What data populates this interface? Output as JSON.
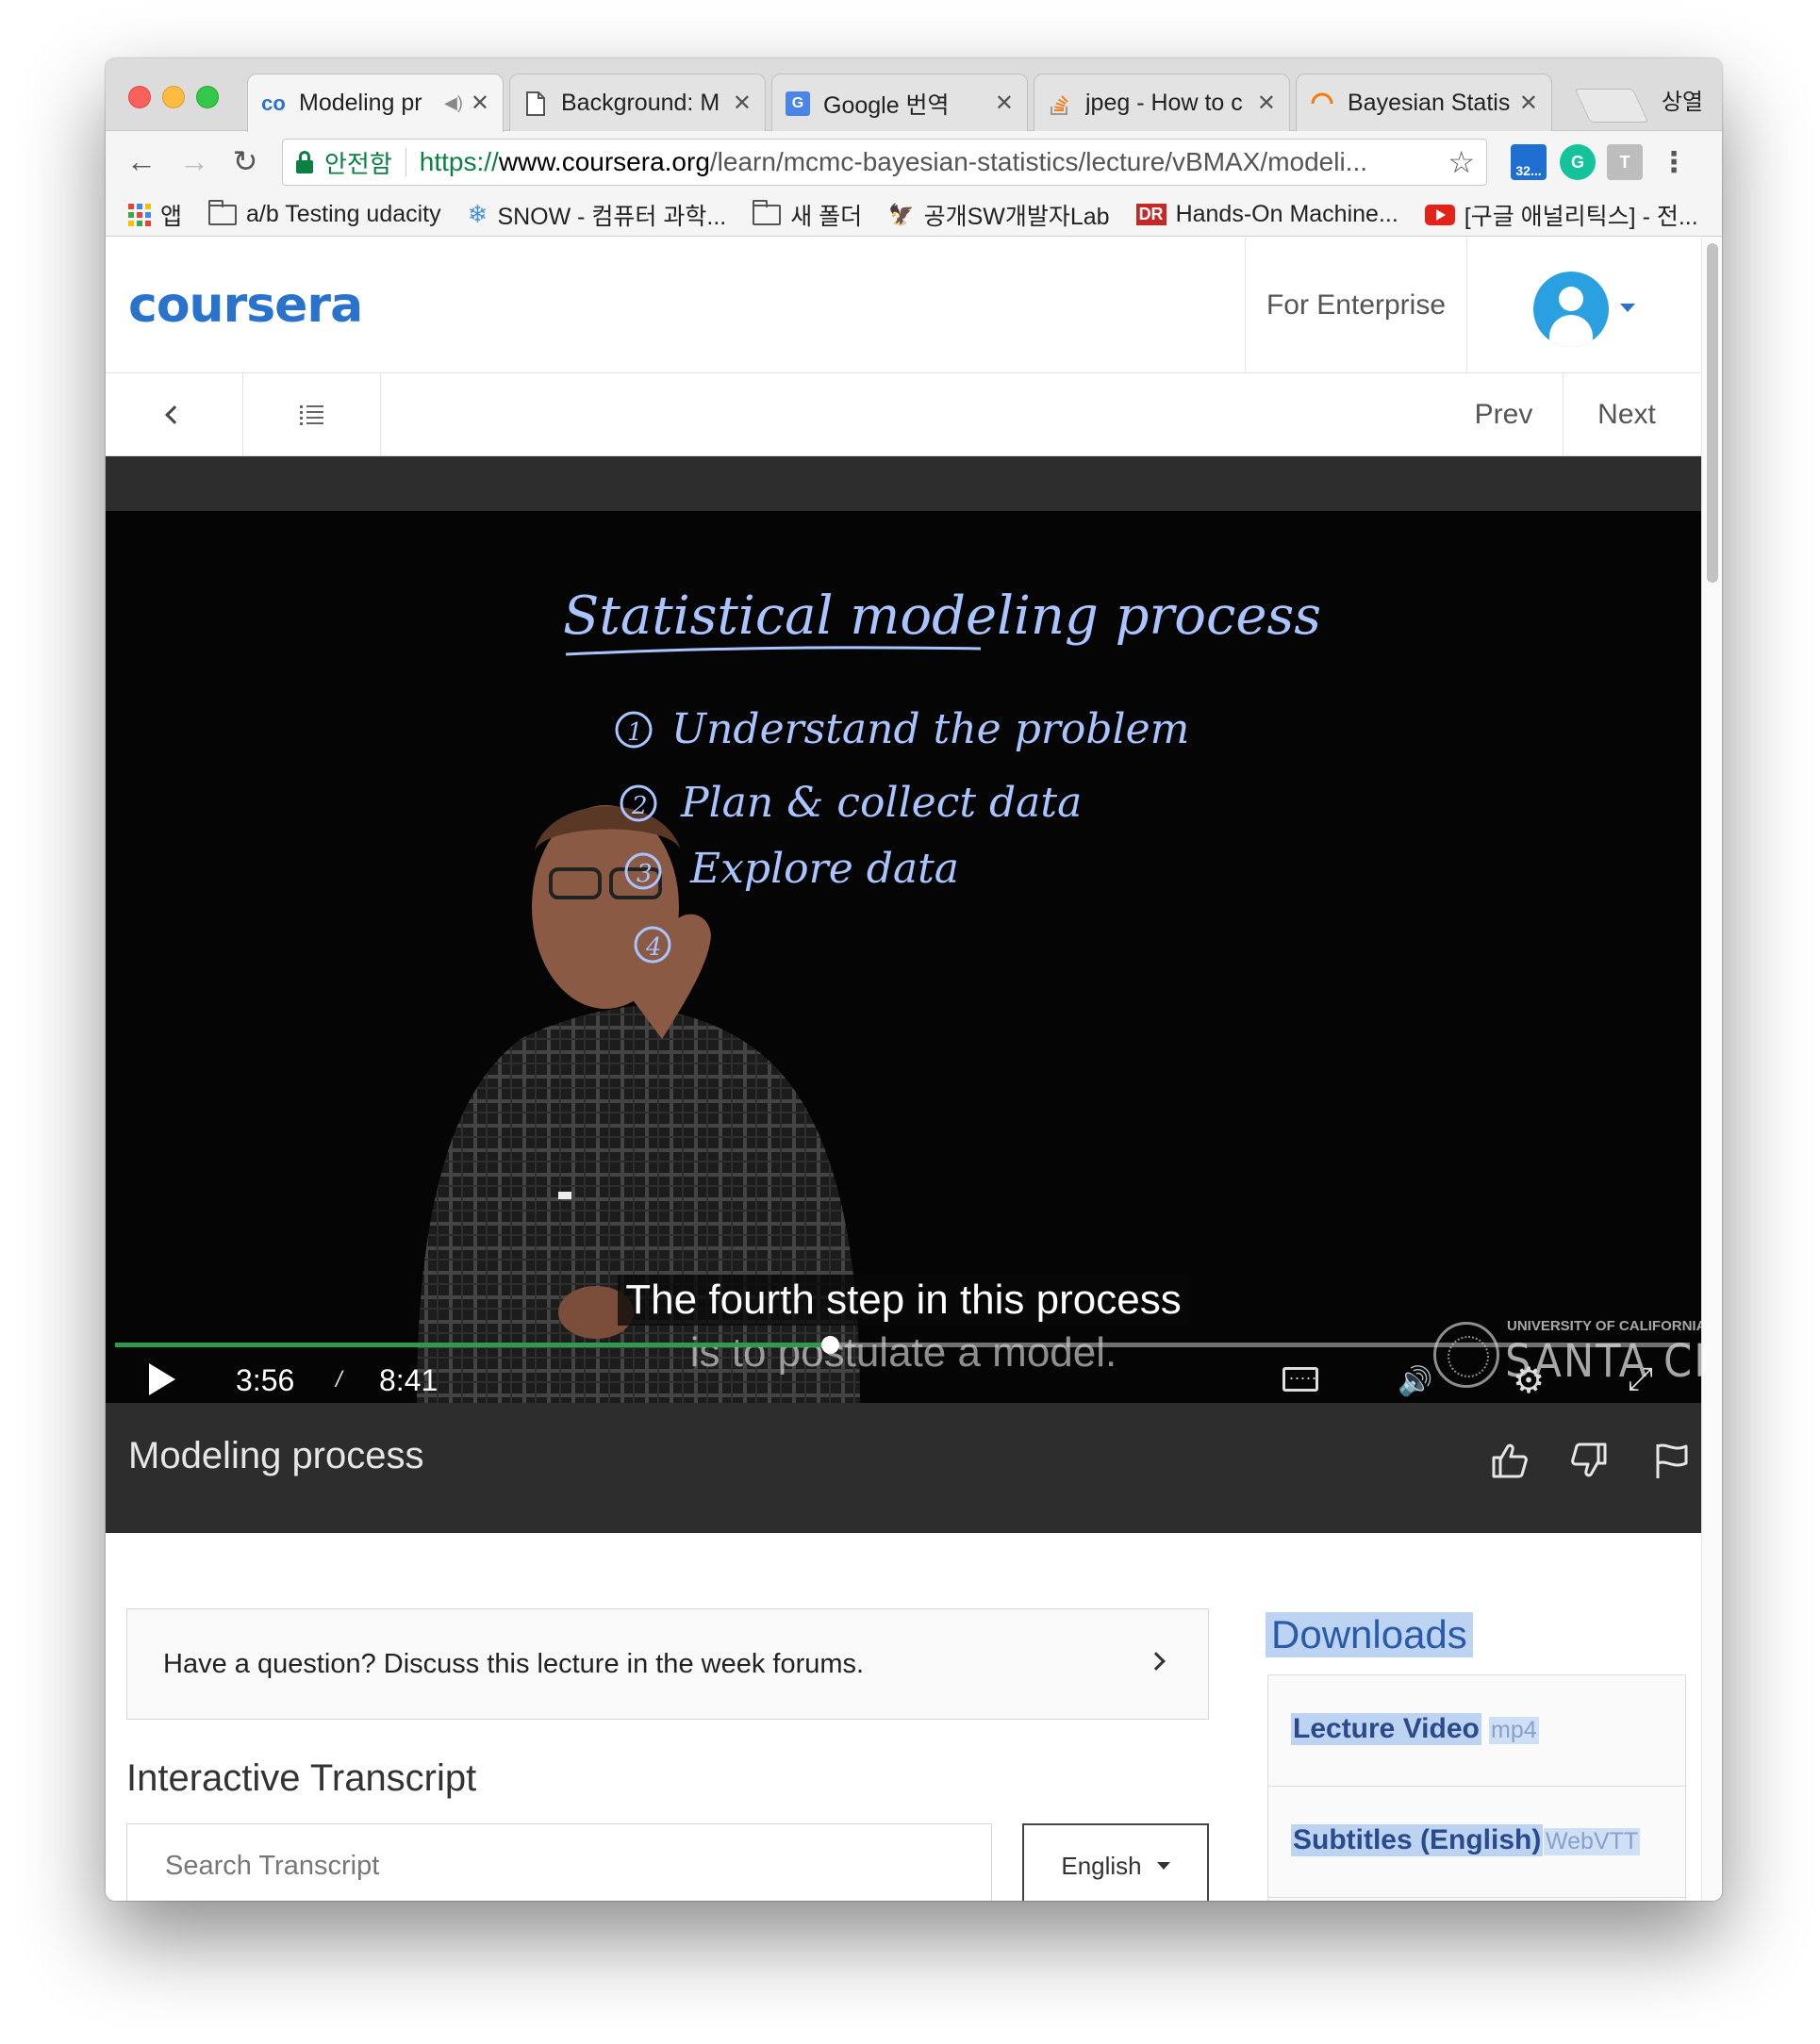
{
  "browser": {
    "tabs": [
      {
        "title": "Modeling pr",
        "icon": "coursera-icon",
        "active": true,
        "audio": true
      },
      {
        "title": "Background: M",
        "icon": "document-icon",
        "active": false
      },
      {
        "title": "Google 번역",
        "icon": "google-translate-icon",
        "active": false
      },
      {
        "title": "jpeg - How to c",
        "icon": "stackoverflow-icon",
        "active": false
      },
      {
        "title": "Bayesian Statis",
        "icon": "loading-icon",
        "active": false
      }
    ],
    "profile_name": "상열",
    "secure_label": "안전함",
    "url": {
      "scheme": "https://",
      "host": "www.coursera.org",
      "path": "/learn/mcmc-bayesian-statistics/lecture/vBMAX/modeli..."
    },
    "extension_badge": "32...",
    "bookmarks": [
      {
        "label": "앱",
        "icon": "apps-grid-icon"
      },
      {
        "label": "a/b Testing udacity",
        "icon": "folder-icon"
      },
      {
        "label": "SNOW - 컴퓨터 과학...",
        "icon": "snowflake-icon"
      },
      {
        "label": "새 폴더",
        "icon": "folder-icon"
      },
      {
        "label": "공개SW개발자Lab",
        "icon": "bird-icon"
      },
      {
        "label": "Hands-On Machine...",
        "icon": "dr-logo-icon"
      },
      {
        "label": "[구글 애널리틱스] - 전...",
        "icon": "youtube-icon"
      }
    ]
  },
  "site": {
    "logo": "coursera",
    "enterprise_link": "For Enterprise",
    "prev_label": "Prev",
    "next_label": "Next"
  },
  "video": {
    "whiteboard_title": "Statistical modeling process",
    "whiteboard_steps": [
      {
        "num": "1",
        "text": "Understand the problem"
      },
      {
        "num": "2",
        "text": "Plan & collect data"
      },
      {
        "num": "3",
        "text": "Explore data"
      },
      {
        "num": "4",
        "text": ""
      }
    ],
    "caption_line1": "The fourth step in this process",
    "caption_line2": "is to postulate a model.",
    "current_time": "3:56",
    "time_separator": "/",
    "duration": "8:41",
    "progress_fraction": 0.454,
    "watermark_top": "UNIVERSITY OF CALIFORNIA",
    "watermark_main": "SANTA CRUZ",
    "accent_color": "#2f9a4e"
  },
  "lecture": {
    "title": "Modeling process"
  },
  "forum": {
    "prompt": "Have a question? Discuss this lecture in the week forums."
  },
  "transcript": {
    "heading": "Interactive Transcript",
    "search_placeholder": "Search Transcript",
    "language": "English"
  },
  "downloads": {
    "heading": "Downloads",
    "items": [
      {
        "name": "Lecture Video",
        "format": "mp4"
      },
      {
        "name": "Subtitles (English)",
        "format": "WebVTT"
      }
    ]
  }
}
